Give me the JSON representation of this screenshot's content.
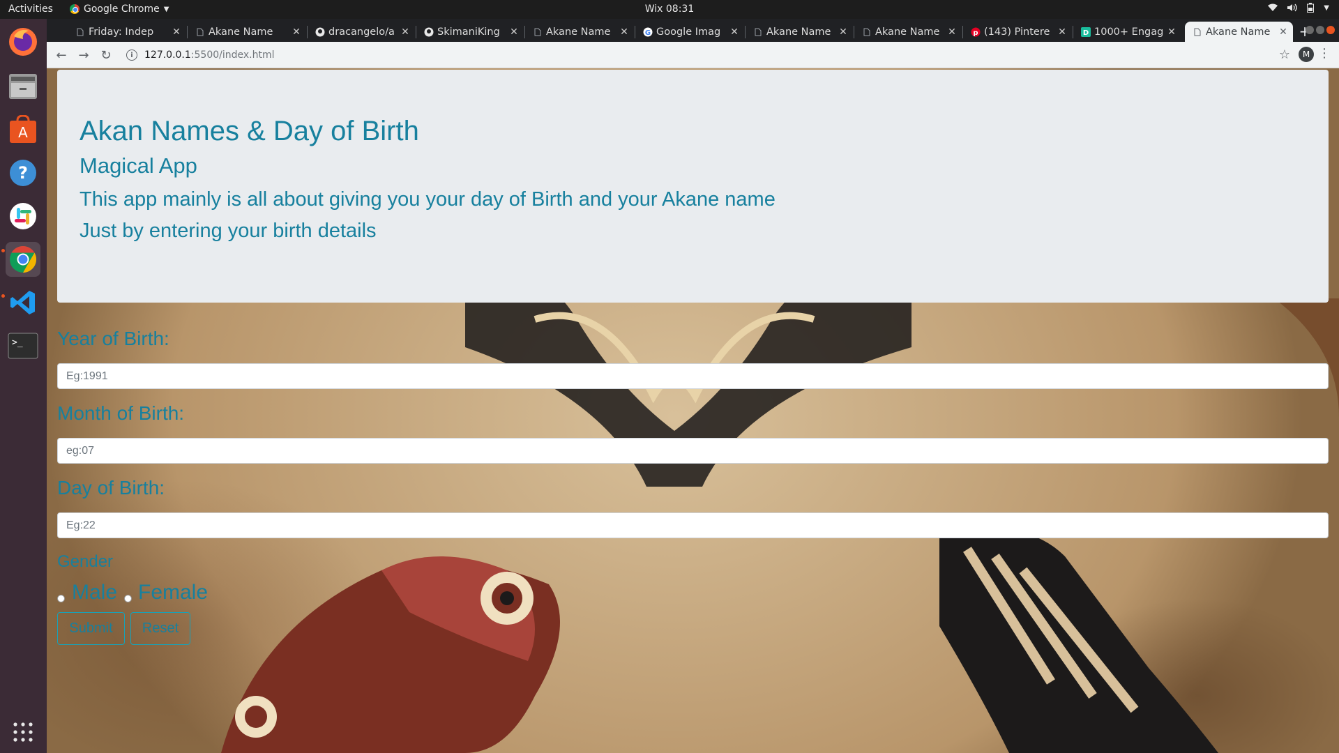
{
  "topbar": {
    "activities": "Activities",
    "app_name": "Google Chrome",
    "clock": "Wix 08:31"
  },
  "dock": {
    "items": [
      "firefox-icon",
      "files-icon",
      "software-center-icon",
      "help-icon",
      "slack-icon",
      "chrome-icon",
      "vscode-icon",
      "terminal-icon"
    ],
    "show_apps": "grid-icon"
  },
  "tabs": [
    {
      "label": "Friday: Indep",
      "icon": "page-icon"
    },
    {
      "label": "Akane Name",
      "icon": "page-icon"
    },
    {
      "label": "dracangelo/a",
      "icon": "github-icon"
    },
    {
      "label": "SkimaniKing",
      "icon": "github-icon"
    },
    {
      "label": "Akane Name",
      "icon": "page-icon"
    },
    {
      "label": "Google Imag",
      "icon": "google-icon"
    },
    {
      "label": "Akane Name",
      "icon": "page-icon"
    },
    {
      "label": "Akane Name",
      "icon": "page-icon"
    },
    {
      "label": "(143) Pintere",
      "icon": "pinterest-icon"
    },
    {
      "label": "1000+ Engag",
      "icon": "d-icon"
    },
    {
      "label": "Akane Name",
      "icon": "page-icon",
      "active": true
    }
  ],
  "toolbar": {
    "url_host": "127.0.0.1",
    "url_path": ":5500/index.html",
    "profile_initial": "M"
  },
  "page": {
    "title": "Akan Names & Day of Birth",
    "subtitle": "Magical App",
    "desc1": "This app mainly is all about giving you your day of Birth and your Akane name",
    "desc2": "Just by entering your birth details",
    "year_label": "Year of Birth:",
    "year_placeholder": "Eg:1991",
    "month_label": "Month of Birth:",
    "month_placeholder": "eg:07",
    "day_label": "Day of Birth:",
    "day_placeholder": "Eg:22",
    "gender_label": "Gender",
    "male_label": "Male",
    "female_label": "Female",
    "submit_label": "Submit",
    "reset_label": "Reset"
  },
  "colors": {
    "heading": "#17809e",
    "jumbotron_bg": "#e9ecef",
    "button_border": "#17a2b8"
  }
}
